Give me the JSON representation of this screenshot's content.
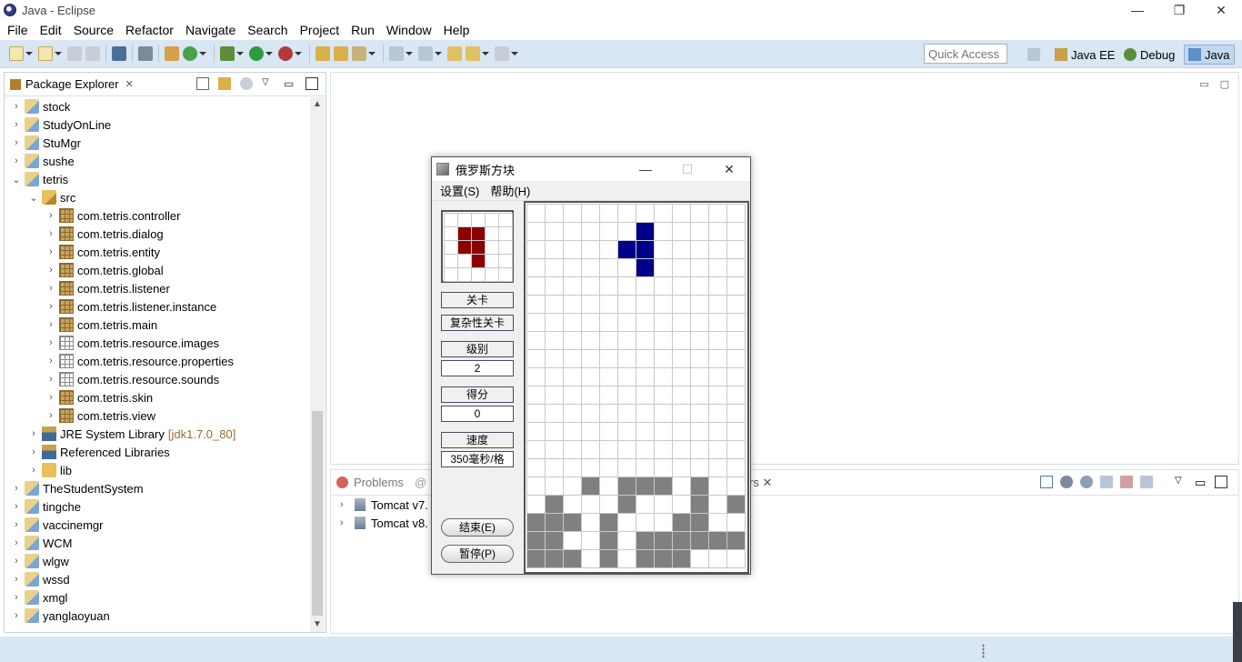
{
  "window": {
    "title": "Java - Eclipse",
    "controls": {
      "minimize": "—",
      "restore": "❐",
      "close": "✕"
    }
  },
  "menu": [
    "File",
    "Edit",
    "Source",
    "Refactor",
    "Navigate",
    "Search",
    "Project",
    "Run",
    "Window",
    "Help"
  ],
  "toolbar": {
    "quick_access_placeholder": "Quick Access",
    "perspectives": [
      "Java EE",
      "Debug",
      "Java"
    ],
    "active_perspective": "Java"
  },
  "package_explorer": {
    "title": "Package Explorer",
    "tree": [
      {
        "label": "stock",
        "depth": 0,
        "expanded": false,
        "icon": "project-icon"
      },
      {
        "label": "StudyOnLine",
        "depth": 0,
        "expanded": false,
        "icon": "project-icon"
      },
      {
        "label": "StuMgr",
        "depth": 0,
        "expanded": false,
        "icon": "project-icon"
      },
      {
        "label": "sushe",
        "depth": 0,
        "expanded": false,
        "icon": "project-icon"
      },
      {
        "label": "tetris",
        "depth": 0,
        "expanded": true,
        "icon": "project-icon"
      },
      {
        "label": "src",
        "depth": 1,
        "expanded": true,
        "icon": "source-folder-icon"
      },
      {
        "label": "com.tetris.controller",
        "depth": 2,
        "expanded": false,
        "icon": "package-icon"
      },
      {
        "label": "com.tetris.dialog",
        "depth": 2,
        "expanded": false,
        "icon": "package-icon"
      },
      {
        "label": "com.tetris.entity",
        "depth": 2,
        "expanded": false,
        "icon": "package-icon"
      },
      {
        "label": "com.tetris.global",
        "depth": 2,
        "expanded": false,
        "icon": "package-icon"
      },
      {
        "label": "com.tetris.listener",
        "depth": 2,
        "expanded": false,
        "icon": "package-icon"
      },
      {
        "label": "com.tetris.listener.instance",
        "depth": 2,
        "expanded": false,
        "icon": "package-icon"
      },
      {
        "label": "com.tetris.main",
        "depth": 2,
        "expanded": false,
        "icon": "package-icon"
      },
      {
        "label": "com.tetris.resource.images",
        "depth": 2,
        "expanded": false,
        "icon": "empty-package-icon"
      },
      {
        "label": "com.tetris.resource.properties",
        "depth": 2,
        "expanded": false,
        "icon": "empty-package-icon"
      },
      {
        "label": "com.tetris.resource.sounds",
        "depth": 2,
        "expanded": false,
        "icon": "empty-package-icon"
      },
      {
        "label": "com.tetris.skin",
        "depth": 2,
        "expanded": false,
        "icon": "package-icon"
      },
      {
        "label": "com.tetris.view",
        "depth": 2,
        "expanded": false,
        "icon": "package-icon"
      },
      {
        "label": "JRE System Library",
        "suffix": "[jdk1.7.0_80]",
        "depth": 1,
        "expanded": false,
        "icon": "library-icon"
      },
      {
        "label": "Referenced Libraries",
        "depth": 1,
        "expanded": false,
        "icon": "library-icon"
      },
      {
        "label": "lib",
        "depth": 1,
        "expanded": false,
        "icon": "folder-icon"
      },
      {
        "label": "TheStudentSystem",
        "depth": 0,
        "expanded": false,
        "icon": "project-icon"
      },
      {
        "label": "tingche",
        "depth": 0,
        "expanded": false,
        "icon": "project-icon"
      },
      {
        "label": "vaccinemgr",
        "depth": 0,
        "expanded": false,
        "icon": "project-icon"
      },
      {
        "label": "WCM",
        "depth": 0,
        "expanded": false,
        "icon": "project-icon"
      },
      {
        "label": "wlgw",
        "depth": 0,
        "expanded": false,
        "icon": "project-icon"
      },
      {
        "label": "wssd",
        "depth": 0,
        "expanded": false,
        "icon": "project-icon"
      },
      {
        "label": "xmgl",
        "depth": 0,
        "expanded": false,
        "icon": "project-icon"
      },
      {
        "label": "yanglaoyuan",
        "depth": 0,
        "expanded": false,
        "icon": "project-icon"
      }
    ]
  },
  "bottom_panel": {
    "tab_problems": "Problems",
    "tab_at": "@",
    "tab_servers_partial": "rs",
    "servers": [
      "Tomcat v7.",
      "Tomcat v8."
    ]
  },
  "tetris": {
    "title": "俄罗斯方块",
    "menu": [
      "设置(S)",
      "帮助(H)"
    ],
    "level_label": "关卡",
    "level_value": "复杂性关卡",
    "grade_label": "级别",
    "grade_value": "2",
    "score_label": "得分",
    "score_value": "0",
    "speed_label": "速度",
    "speed_value": "350毫秒/格",
    "end_button": "结束(E)",
    "pause_button": "暂停(P)",
    "colors": {
      "next_piece": "#8b0000",
      "active_piece": "#00008b",
      "settled": "#808080"
    },
    "next_piece_cells": [
      [
        1,
        1
      ],
      [
        2,
        1
      ],
      [
        1,
        2
      ],
      [
        2,
        2
      ],
      [
        2,
        3
      ]
    ],
    "active_piece_cells": [
      [
        6,
        1
      ],
      [
        6,
        2
      ],
      [
        5,
        2
      ],
      [
        6,
        3
      ]
    ],
    "settled_cells": [
      [
        3,
        15
      ],
      [
        5,
        15
      ],
      [
        6,
        15
      ],
      [
        7,
        15
      ],
      [
        9,
        15
      ],
      [
        1,
        16
      ],
      [
        5,
        16
      ],
      [
        9,
        16
      ],
      [
        11,
        16
      ],
      [
        0,
        17
      ],
      [
        1,
        17
      ],
      [
        2,
        17
      ],
      [
        4,
        17
      ],
      [
        8,
        17
      ],
      [
        9,
        17
      ],
      [
        0,
        18
      ],
      [
        1,
        18
      ],
      [
        4,
        18
      ],
      [
        6,
        18
      ],
      [
        7,
        18
      ],
      [
        8,
        18
      ],
      [
        9,
        18
      ],
      [
        10,
        18
      ],
      [
        11,
        18
      ],
      [
        0,
        19
      ],
      [
        1,
        19
      ],
      [
        2,
        19
      ],
      [
        4,
        19
      ],
      [
        6,
        19
      ],
      [
        7,
        19
      ],
      [
        8,
        19
      ]
    ]
  }
}
